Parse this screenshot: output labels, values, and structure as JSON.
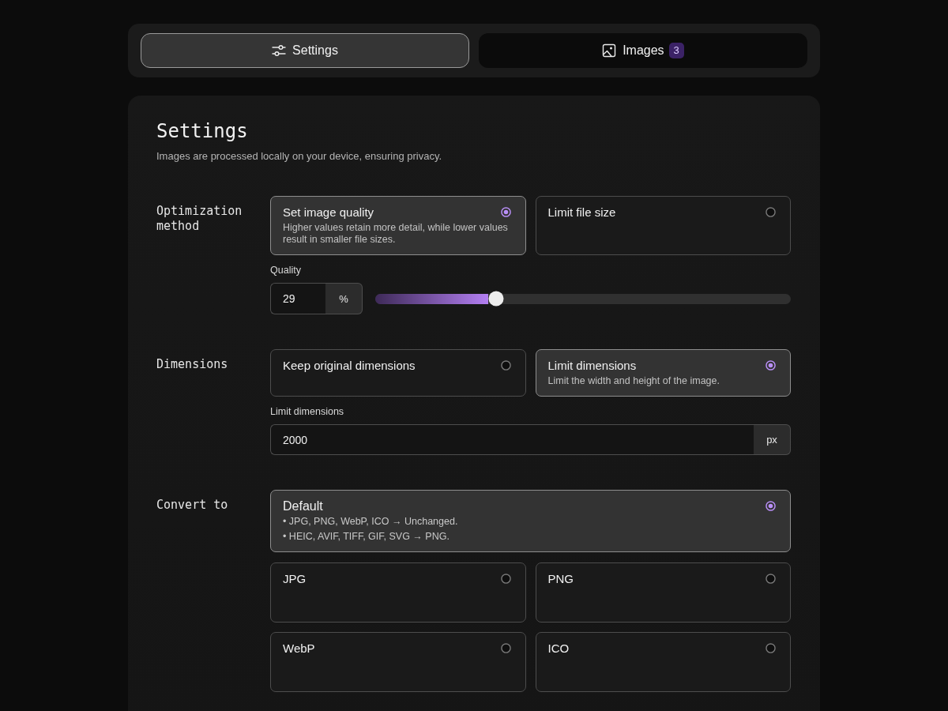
{
  "tabs": [
    {
      "label": "Settings",
      "selected": true
    },
    {
      "label": "Images",
      "selected": false,
      "badge": "3"
    }
  ],
  "panel": {
    "title": "Settings",
    "subtitle": "Images are processed locally on your device, ensuring privacy."
  },
  "sections": [
    {
      "label": "Optimization method",
      "options": [
        {
          "title": "Set image quality",
          "description": "Higher values retain more detail, while lower values result in smaller file sizes.",
          "selected": true
        },
        {
          "title": "Limit file size",
          "selected": false
        }
      ],
      "control": {
        "kind": "slider",
        "label": "Quality",
        "value": "29",
        "unit": "%",
        "level": 0.29
      }
    },
    {
      "label": "Dimensions",
      "options": [
        {
          "title": "Keep original dimensions",
          "selected": false
        },
        {
          "title": "Limit dimensions",
          "description": "Limit the width and height of the image.",
          "selected": true
        }
      ],
      "control": {
        "kind": "input",
        "label": "Limit dimensions",
        "value": "2000",
        "unit": "px"
      }
    },
    {
      "label": "Convert to",
      "default_option": {
        "title": "Default",
        "notes": [
          "• JPG, PNG, WebP, ICO → Unchanged.",
          "• HEIC, AVIF, TIFF, GIF, SVG → PNG."
        ],
        "selected": true
      },
      "options": [
        {
          "title": "JPG",
          "selected": false
        },
        {
          "title": "PNG",
          "selected": false
        },
        {
          "title": "WebP",
          "selected": false
        },
        {
          "title": "ICO",
          "selected": false
        }
      ]
    }
  ]
}
